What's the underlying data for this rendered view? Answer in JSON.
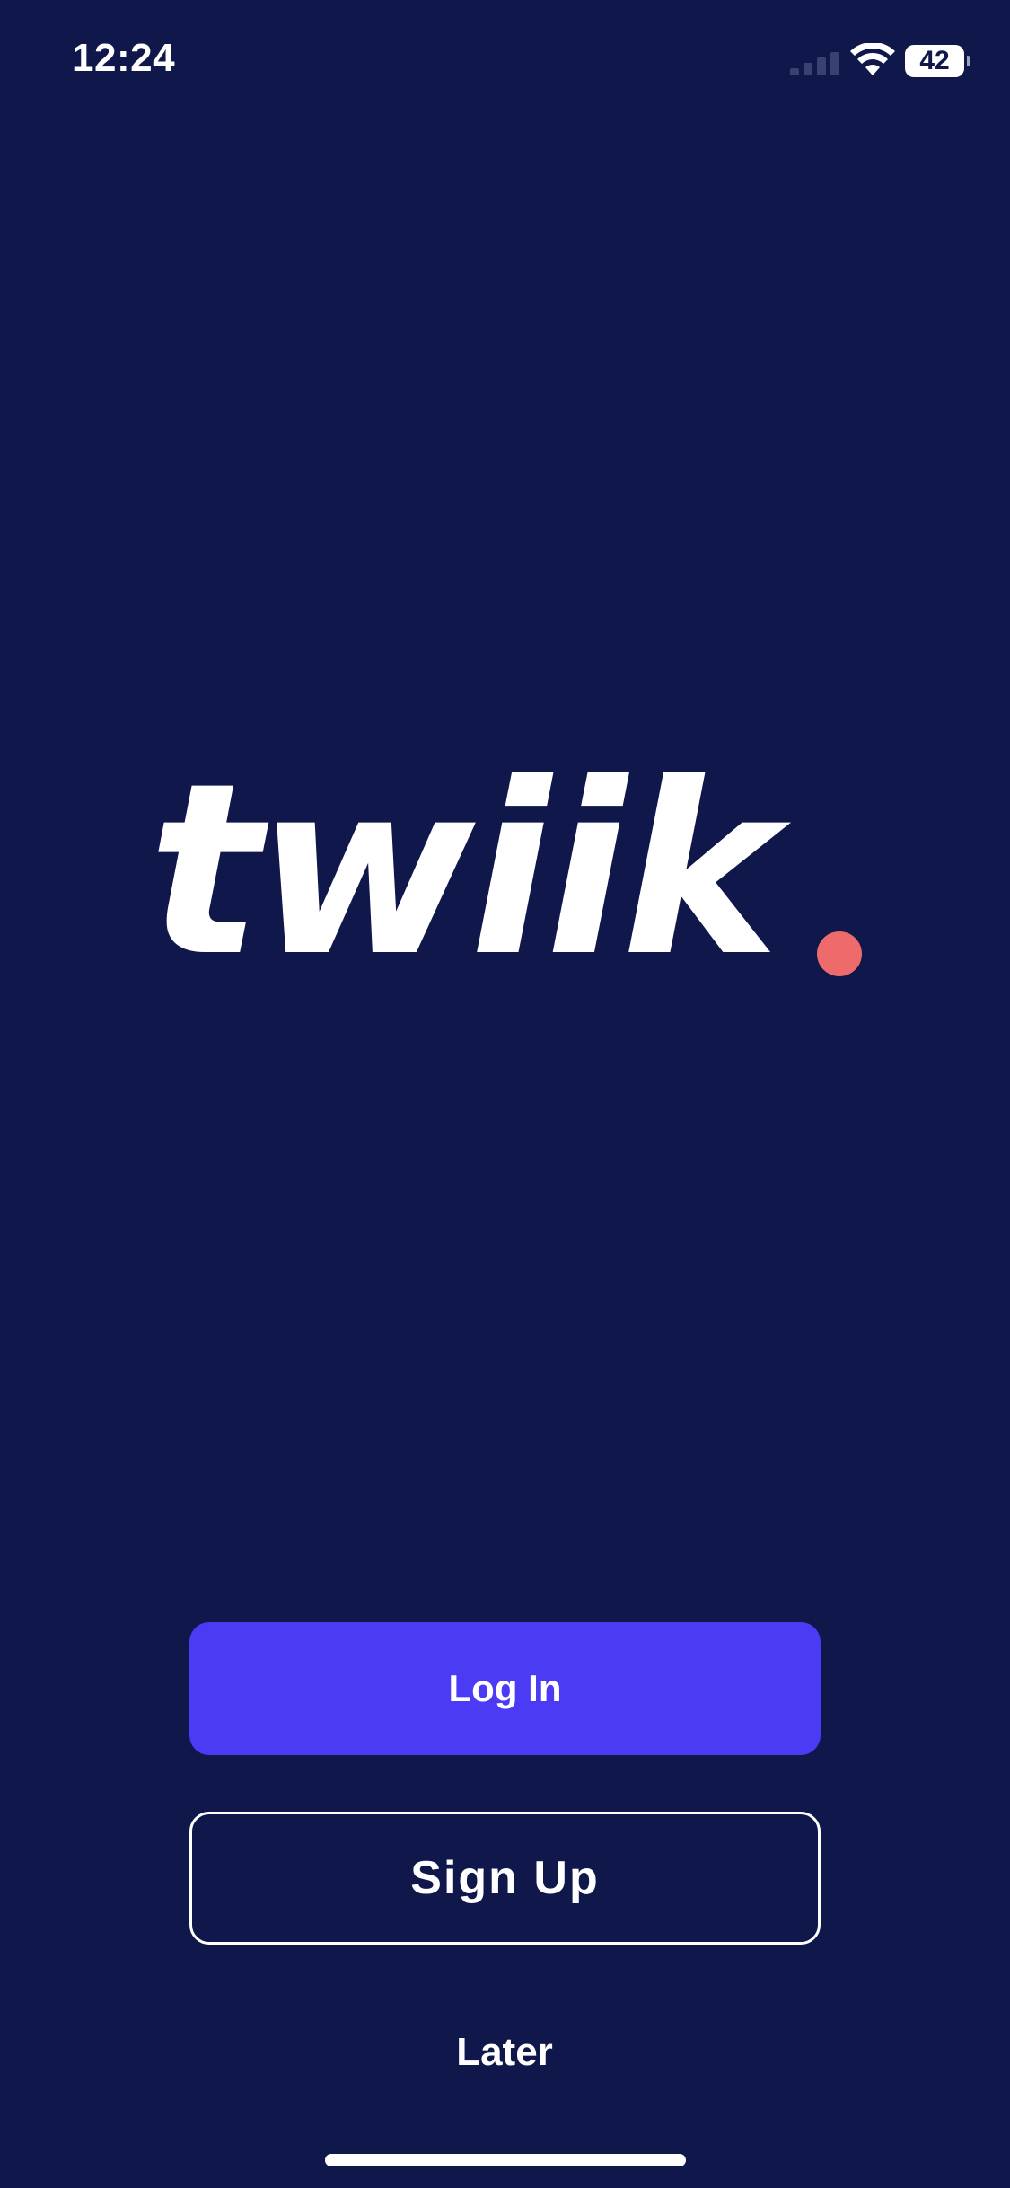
{
  "status_bar": {
    "time": "12:24",
    "battery_level": "42",
    "battery_fraction": 0.42,
    "icons": [
      "signal-icon",
      "wifi-icon",
      "battery-icon"
    ]
  },
  "logo": {
    "wordmark": "twiik",
    "dot_color": "#ef6b6b"
  },
  "actions": {
    "login_label": "Log In",
    "signup_label": "Sign Up",
    "later_label": "Later"
  },
  "colors": {
    "background": "#10174b",
    "primary": "#4b3bf5",
    "text": "#ffffff"
  }
}
